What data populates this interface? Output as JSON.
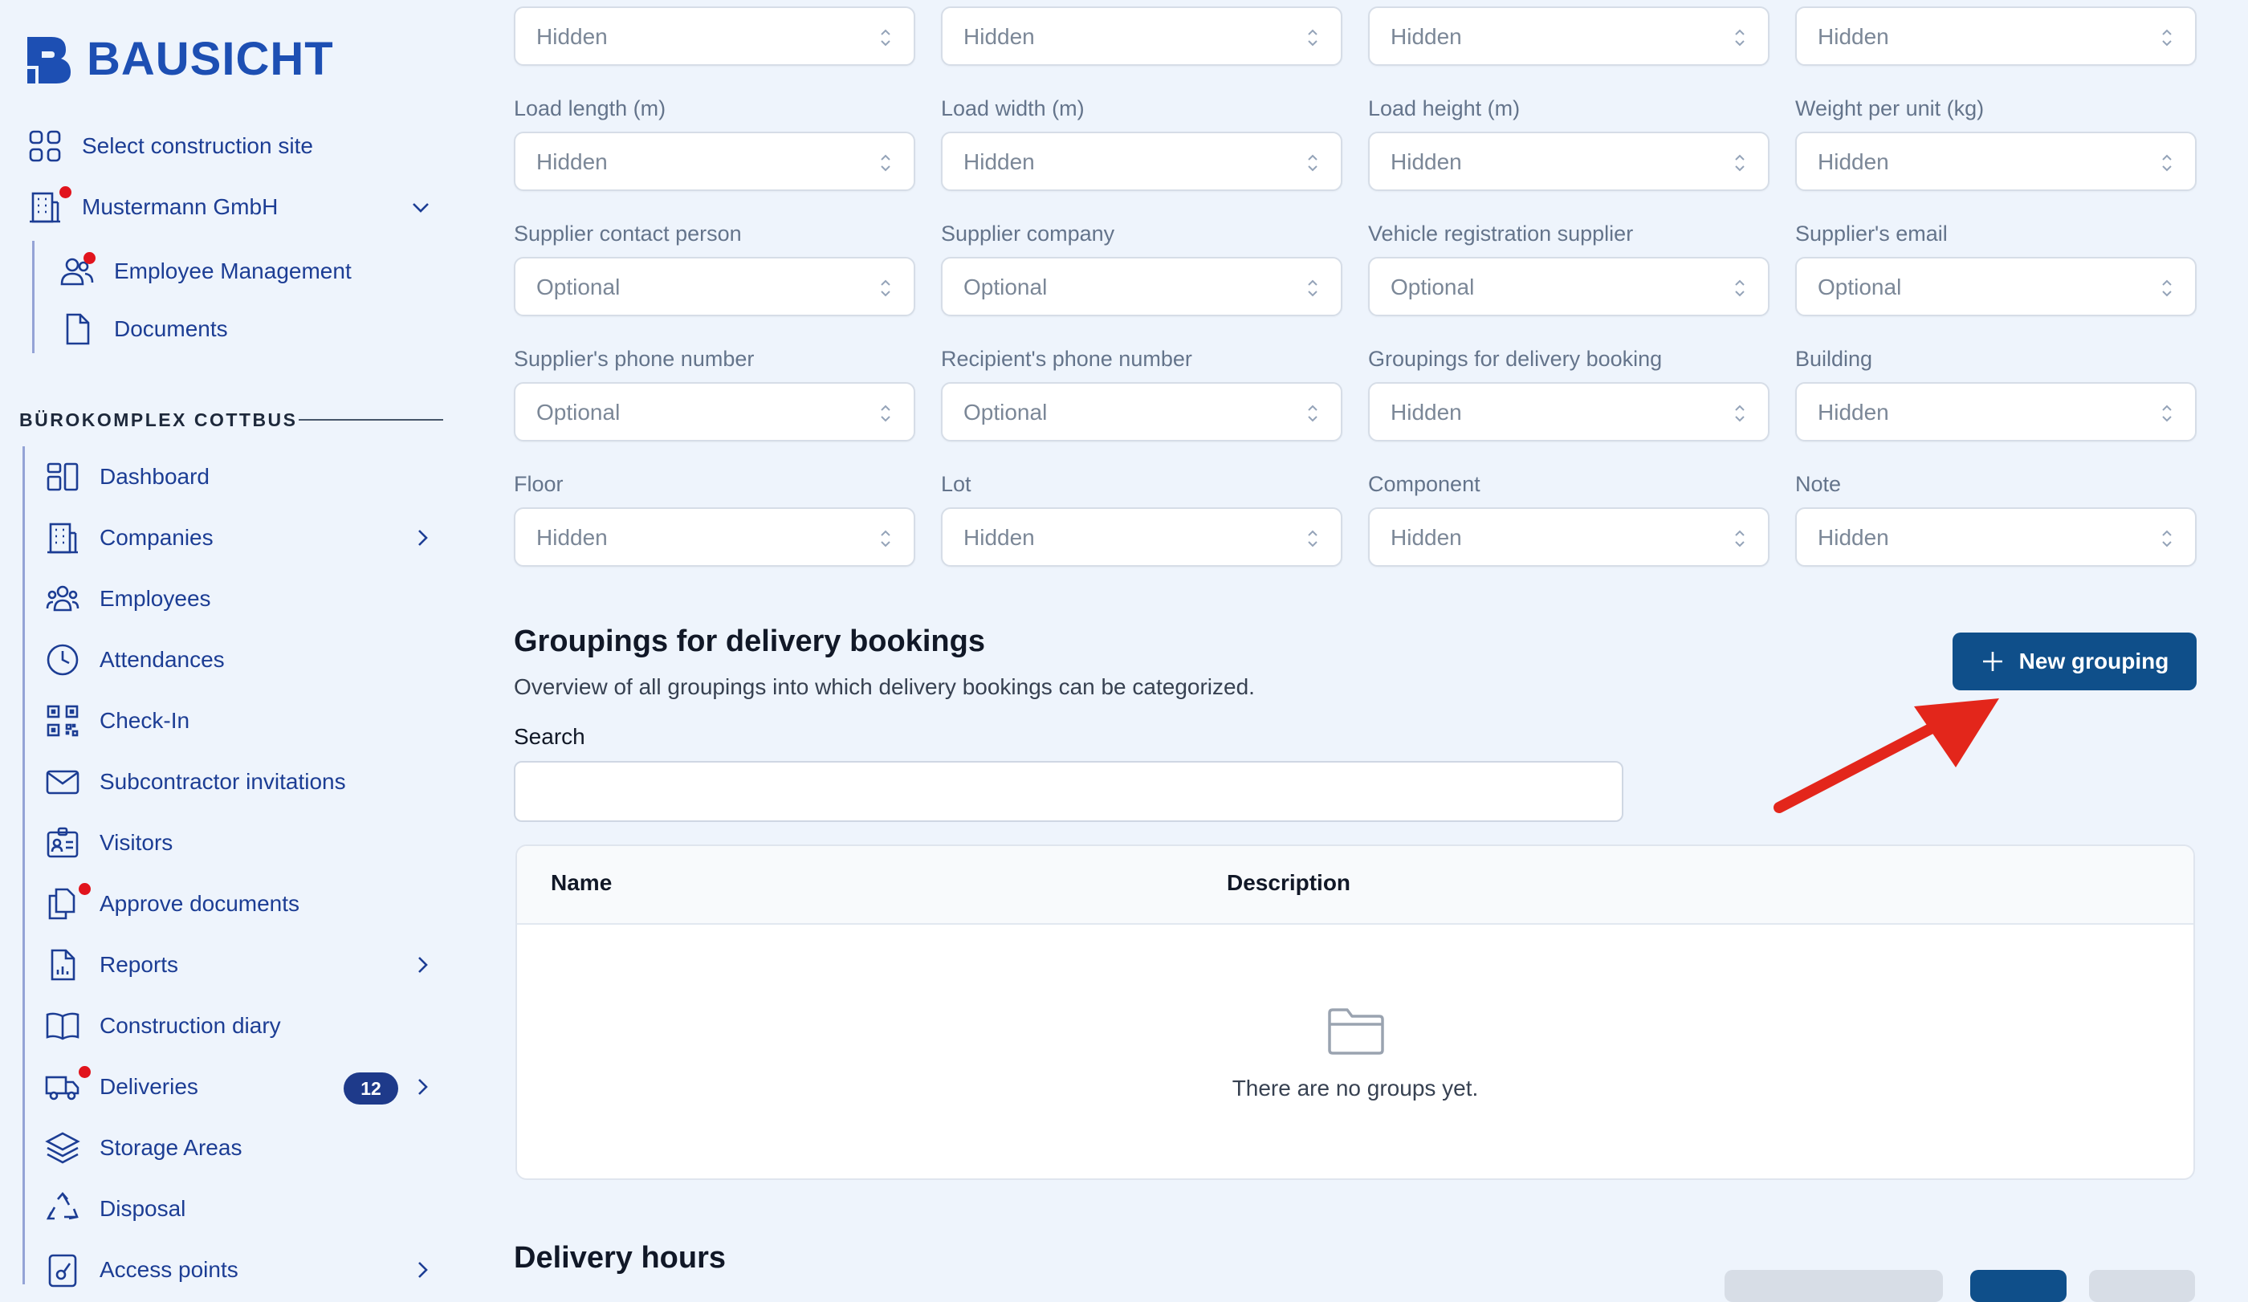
{
  "brand": {
    "name": "BAUSICHT"
  },
  "sidebar": {
    "select_site": "Select construction site",
    "company": "Mustermann GmbH",
    "company_sub": [
      {
        "label": "Employee Management"
      },
      {
        "label": "Documents"
      }
    ],
    "section_title": "BÜROKOMPLEX COTTBUS",
    "items": [
      {
        "label": "Dashboard"
      },
      {
        "label": "Companies"
      },
      {
        "label": "Employees"
      },
      {
        "label": "Attendances"
      },
      {
        "label": "Check-In"
      },
      {
        "label": "Subcontractor invitations"
      },
      {
        "label": "Visitors"
      },
      {
        "label": "Approve documents"
      },
      {
        "label": "Reports"
      },
      {
        "label": "Construction diary"
      },
      {
        "label": "Deliveries",
        "badge": "12"
      },
      {
        "label": "Storage Areas"
      },
      {
        "label": "Disposal"
      },
      {
        "label": "Access points"
      }
    ]
  },
  "fields": {
    "row0": [
      {
        "value": "Hidden"
      },
      {
        "value": "Hidden"
      },
      {
        "value": "Hidden"
      },
      {
        "value": "Hidden"
      }
    ],
    "row1": [
      {
        "label": "Load length (m)",
        "value": "Hidden"
      },
      {
        "label": "Load width (m)",
        "value": "Hidden"
      },
      {
        "label": "Load height (m)",
        "value": "Hidden"
      },
      {
        "label": "Weight per unit (kg)",
        "value": "Hidden"
      }
    ],
    "row2": [
      {
        "label": "Supplier contact person",
        "value": "Optional"
      },
      {
        "label": "Supplier company",
        "value": "Optional"
      },
      {
        "label": "Vehicle registration supplier",
        "value": "Optional"
      },
      {
        "label": "Supplier's email",
        "value": "Optional"
      }
    ],
    "row3": [
      {
        "label": "Supplier's phone number",
        "value": "Optional"
      },
      {
        "label": "Recipient's phone number",
        "value": "Optional"
      },
      {
        "label": "Groupings for delivery booking",
        "value": "Hidden"
      },
      {
        "label": "Building",
        "value": "Hidden"
      }
    ],
    "row4": [
      {
        "label": "Floor",
        "value": "Hidden"
      },
      {
        "label": "Lot",
        "value": "Hidden"
      },
      {
        "label": "Component",
        "value": "Hidden"
      },
      {
        "label": "Note",
        "value": "Hidden"
      }
    ]
  },
  "groupings": {
    "title": "Groupings for delivery bookings",
    "subtitle": "Overview of all groupings into which delivery bookings can be categorized.",
    "new_button": "New grouping",
    "search_label": "Search",
    "search_value": "",
    "columns": [
      "Name",
      "Description"
    ],
    "empty_text": "There are no groups yet."
  },
  "delivery_hours": {
    "title": "Delivery hours"
  },
  "colors": {
    "accent": "#1d4fb3",
    "nav_text": "#1c3d94",
    "primary_button": "#0f4f8a",
    "notification_dot": "#e1141d",
    "arrow": "#e3261b"
  }
}
